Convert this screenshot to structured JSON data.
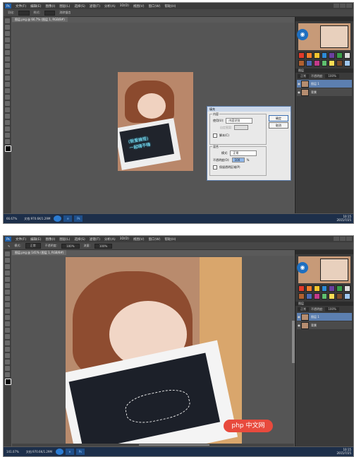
{
  "screen1": {
    "menu": [
      "文件(F)",
      "编辑(E)",
      "图像(I)",
      "图层(L)",
      "选择(S)",
      "滤镜(T)",
      "分析(A)",
      "3D(D)",
      "视图(V)",
      "窗口(W)",
      "帮助(H)"
    ],
    "options": {
      "feather_label": "羽化:",
      "tolerance_label": "样式:",
      "anti_alias": "消除锯齿"
    },
    "tab": "图层.png @ 66.7% (图层 1, RGB/8#)",
    "photo_caption_line1": "(就爱搞怪)",
    "photo_caption_line2": "一起嗨不嗨",
    "dialog": {
      "title": "填充",
      "contents_group": "内容",
      "use_label": "使用(U):",
      "use_value": "内容识别",
      "custom_pattern_label": "自定图案:",
      "script_label": "脚本(C)",
      "blending_group": "混合",
      "mode_label": "模式:",
      "mode_value": "正常",
      "opacity_label": "不透明度(O):",
      "opacity_value": "100",
      "opacity_unit": "%",
      "preserve_label": "保留透明区域(P)",
      "ok_label": "确定",
      "cancel_label": "取消"
    },
    "status_zoom": "66.67%",
    "status_doc": "文档:970.6K/1.29M",
    "tray_time": "10:15",
    "tray_date": "2015/7/25"
  },
  "screen2": {
    "menu": [
      "文件(F)",
      "编辑(E)",
      "图像(I)",
      "图层(L)",
      "选择(S)",
      "滤镜(T)",
      "分析(A)",
      "3D(D)",
      "视图(V)",
      "窗口(W)",
      "帮助(H)"
    ],
    "options": {
      "mode_label": "模式:",
      "mode_value": "正常",
      "opacity_label": "不透明度:",
      "opacity_value": "100%",
      "flow_label": "流量:",
      "flow_value": "100%"
    },
    "tab": "图层.png @ 141% (图层 1, RGB/8#)",
    "status_zoom": "141.07%",
    "status_doc": "文档:970.6K/1.29M",
    "watermark": "php 中文网",
    "tray_time": "10:15",
    "tray_date": "2015/7/25"
  },
  "layers": {
    "tab": "图层",
    "blend_mode": "正常",
    "opacity_label": "不透明度:",
    "opacity_value": "100%",
    "layer1": "图层 1",
    "layer0": "背景"
  },
  "swatch_colors": [
    "#e23a2a",
    "#f07b2b",
    "#f4c52f",
    "#2e8bd6",
    "#6b3fa0",
    "#3a9f4a",
    "#dcdcdc",
    "#b06030",
    "#4b6cb7",
    "#c33a8a",
    "#5fbf6f",
    "#ffdd55",
    "#7a4a2a",
    "#9fc7ef"
  ]
}
